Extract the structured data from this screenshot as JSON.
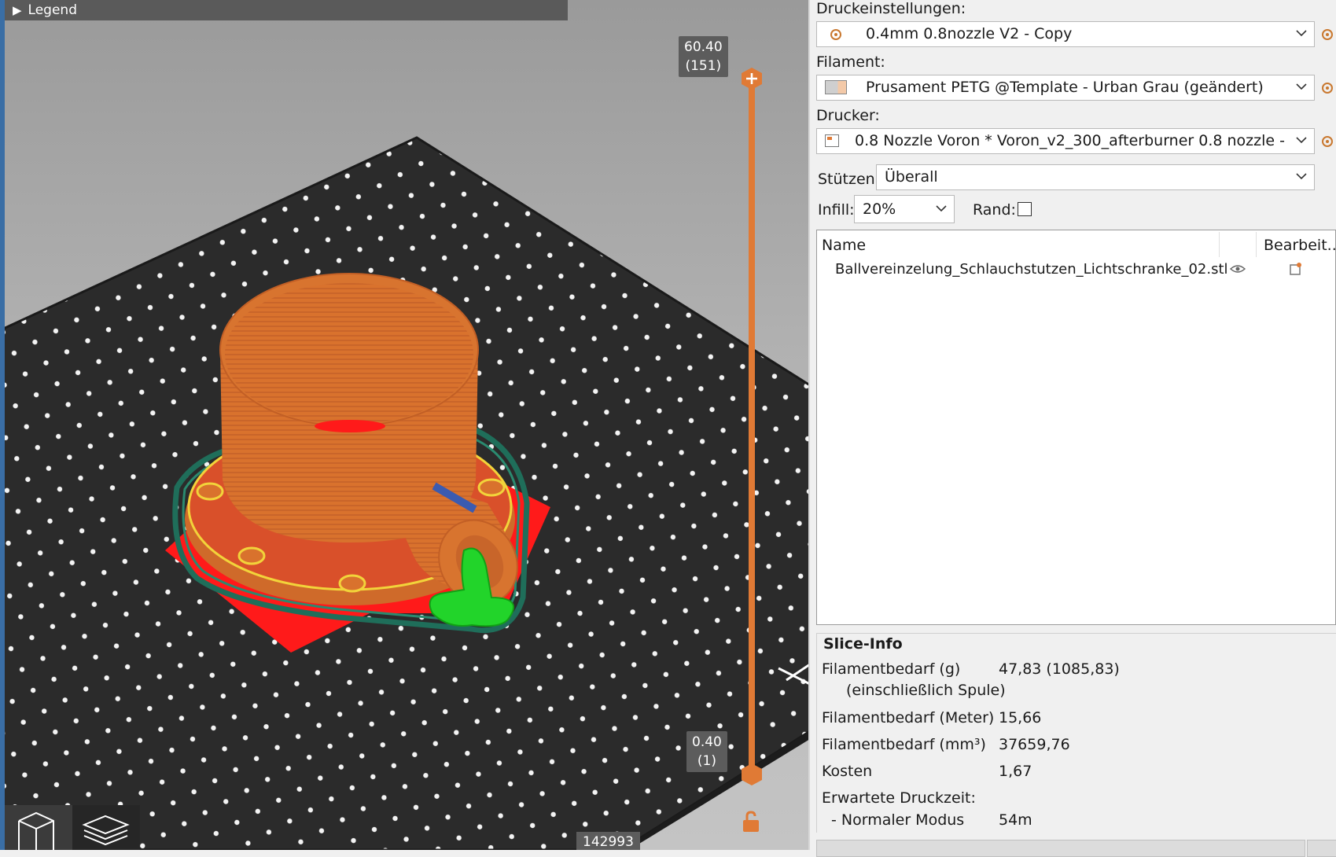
{
  "legend": {
    "label": "Legend"
  },
  "layer_slider": {
    "top_height": "60.40",
    "top_layer": "(151)",
    "bottom_height": "0.40",
    "bottom_layer": "(1)"
  },
  "move_counter": "142993",
  "colors": {
    "accent": "#e07a35",
    "part_orange": "#d8742f",
    "support_green": "#22d42a",
    "skirt_teal": "#1f6e5a",
    "brim_red": "#ff1a1a",
    "bed": "#2a2a2a"
  },
  "settings": {
    "print_label": "Druckeinstellungen:",
    "print_value": "0.4mm 0.8nozzle V2 - Copy",
    "filament_label": "Filament:",
    "filament_value": "Prusament PETG @Template - Urban Grau (geändert)",
    "printer_label": "Drucker:",
    "printer_value": "0.8 Nozzle Voron  * Voron_v2_300_afterburner 0.8 nozzle - 1. ...",
    "supports_label": "Stützen:",
    "supports_value": "Überall",
    "infill_label": "Infill:",
    "infill_value": "20%",
    "brim_label": "Rand:",
    "brim_checked": false
  },
  "object_list": {
    "col_name": "Name",
    "col_edit": "Bearbeit...",
    "rows": [
      {
        "name": "Ballvereinzelung_Schlauchstutzen_Lichtschranke_02.stl"
      }
    ]
  },
  "slice_info": {
    "title": "Slice-Info",
    "rows": [
      {
        "label": "Filamentbedarf (g)",
        "label2": "(einschließlich Spule)",
        "value": "47,83 (1085,83)"
      },
      {
        "label": "Filamentbedarf (Meter)",
        "value": "15,66"
      },
      {
        "label": "Filamentbedarf (mm³)",
        "value": "37659,76"
      },
      {
        "label": "Kosten",
        "value": "1,67"
      },
      {
        "label": "Erwartete Druckzeit:",
        "value": ""
      },
      {
        "label": "- Normaler Modus",
        "value": "54m"
      }
    ]
  }
}
